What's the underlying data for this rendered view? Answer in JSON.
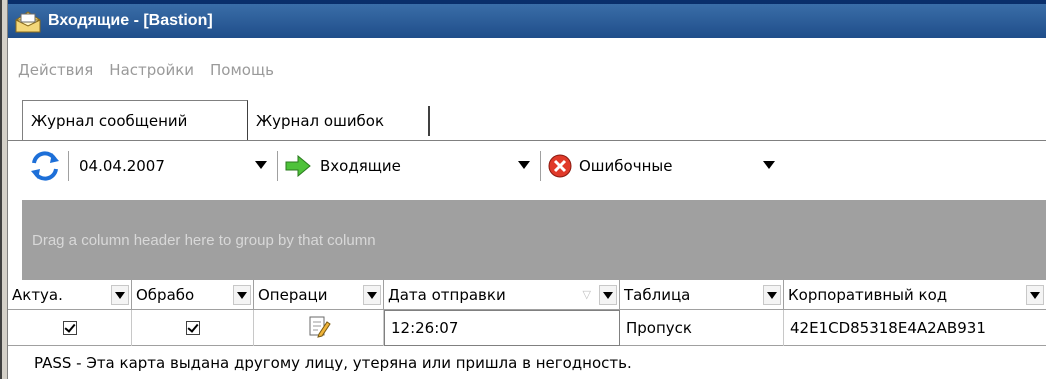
{
  "window": {
    "title": "Входящие - [Bastion]"
  },
  "menu": [
    "Действия",
    "Настройки",
    "Помощь"
  ],
  "tabs": {
    "messages": "Журнал сообщений",
    "errors": "Журнал ошибок"
  },
  "toolbar": {
    "date": "04.04.2007",
    "direction": "Входящие",
    "status": "Ошибочные"
  },
  "groupby_hint": "Drag a column header here to group by that column",
  "columns": [
    "Актуа.",
    "Обрабо",
    "Операци",
    "Дата отправки",
    "Таблица",
    "Корпоративный код"
  ],
  "row": {
    "actual": true,
    "processed": true,
    "time": "12:26:07",
    "table": "Пропуск",
    "corp_code": "42E1CD85318E4A2AB931"
  },
  "description": "PASS - Эта карта выдана другому лицу, утеряна или пришла в негодность."
}
